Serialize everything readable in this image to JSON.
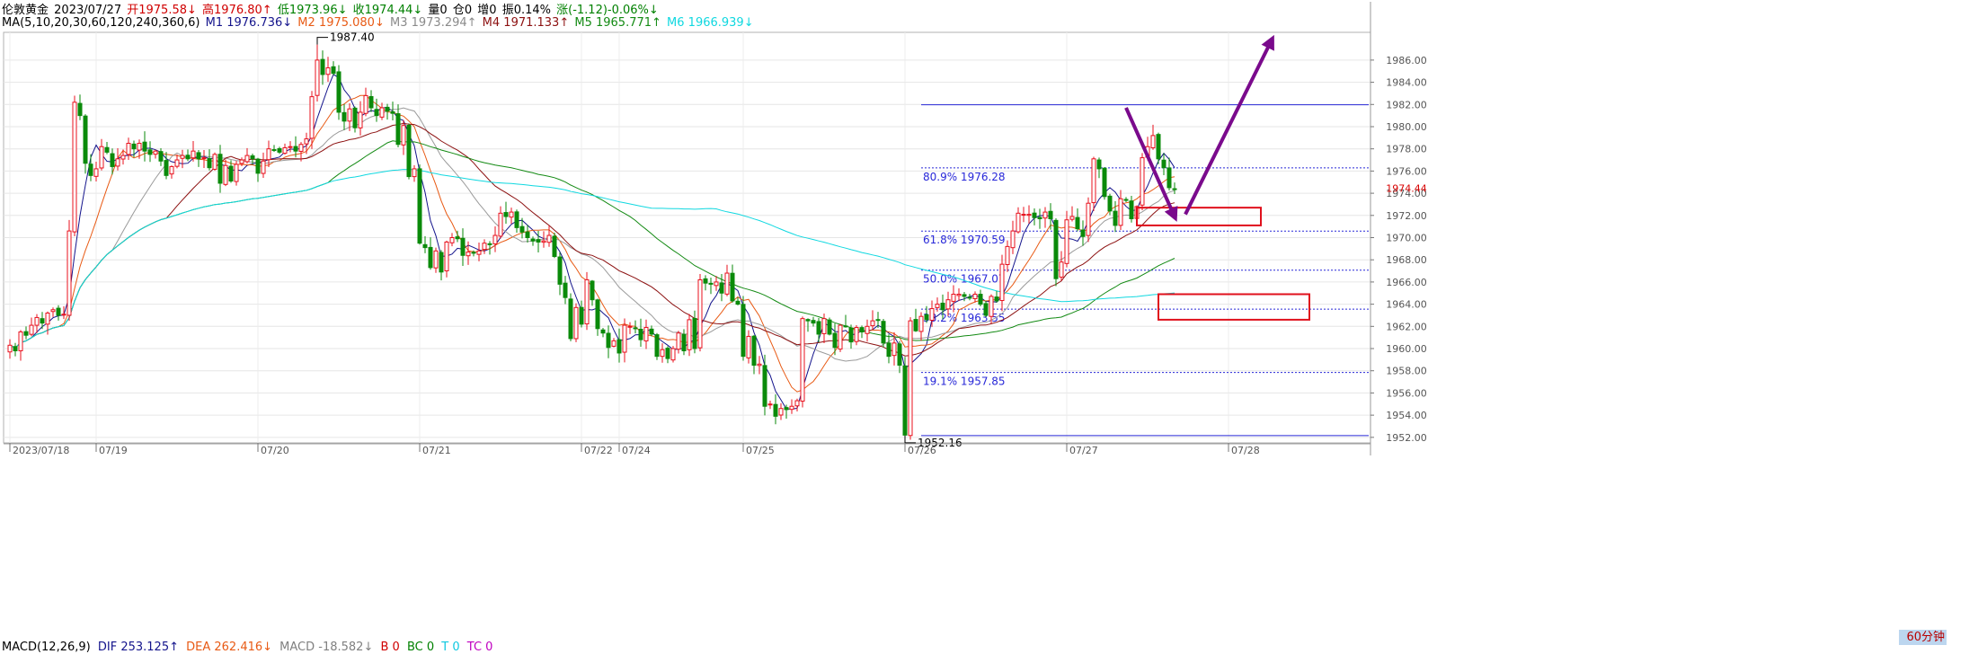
{
  "header": {
    "instrument": "伦敦黄金",
    "date": "2023/07/27",
    "open": "开1975.58↓",
    "high": "高1976.80↑",
    "low": "低1973.96↓",
    "close": "收1974.44↓",
    "volume": "量0",
    "position": "仓0",
    "increase": "增0",
    "amplitude": "振0.14%",
    "change": "涨(-1.12)-0.06%↓"
  },
  "ma_header": {
    "label": "MA(5,10,20,30,60,120,240,360,6)",
    "m1": "M1 1976.736↓",
    "m2": "M2 1975.080↓",
    "m3": "M3 1973.294↑",
    "m4": "M4 1971.133↑",
    "m5": "M5 1965.771↑",
    "m6": "M6 1966.939↓"
  },
  "footer": {
    "macd_label": "MACD(12,26,9)",
    "dif": "DIF 253.125↑",
    "dea": "DEA 262.416↓",
    "macd": "MACD -18.582↓",
    "b": "B 0",
    "bc": "BC 0",
    "t": "T 0",
    "tc": "TC 0"
  },
  "timeframe_button": "60分钟",
  "colors": {
    "up": "#e8101c",
    "down": "#0a8a0a",
    "m1": "#14148c",
    "m2": "#e85a14",
    "m3": "#9a9a9a",
    "m4": "#8c1010",
    "m5": "#138a13",
    "m6": "#10d8e0",
    "fib": "#2828d8",
    "arrow": "#7a0a8c",
    "box": "#e0101c",
    "axis_price_highlight": "#d80000"
  },
  "chart_data": {
    "type": "candlestick",
    "title": "伦敦黄金 60分钟",
    "ylim": [
      1951.5,
      1988.5
    ],
    "y_ticks": [
      "1986.00",
      "1984.00",
      "1982.00",
      "1980.00",
      "1978.00",
      "1976.00",
      "1974.00",
      "1972.00",
      "1970.00",
      "1968.00",
      "1966.00",
      "1964.00",
      "1962.00",
      "1960.00",
      "1958.00",
      "1956.00",
      "1954.00",
      "1952.00"
    ],
    "y_tick_values": [
      1986,
      1984,
      1982,
      1980,
      1978,
      1976,
      1974,
      1972,
      1970,
      1968,
      1966,
      1964,
      1962,
      1960,
      1958,
      1956,
      1954,
      1952
    ],
    "current_price": "1974.44",
    "current_price_value": 1974.44,
    "x_labels": [
      {
        "label": "2023/07/18",
        "bar": 0
      },
      {
        "label": "07/19",
        "bar": 16
      },
      {
        "label": "07/20",
        "bar": 46
      },
      {
        "label": "07/21",
        "bar": 76
      },
      {
        "label": "07/22",
        "bar": 106
      },
      {
        "label": "07/24",
        "bar": 113
      },
      {
        "label": "07/25",
        "bar": 136
      },
      {
        "label": "07/26",
        "bar": 166
      },
      {
        "label": "07/27",
        "bar": 196
      },
      {
        "label": "07/28",
        "bar": 226
      }
    ],
    "bar_count": 244,
    "max_annotation": {
      "label": "1987.40",
      "value": 1987.4
    },
    "min_annotation": {
      "label": "1952.16",
      "value": 1952.16
    },
    "closes": [
      1960.3,
      1959.8,
      1961.5,
      1961.2,
      1962.1,
      1962.8,
      1962.3,
      1963.2,
      1963.5,
      1963.0,
      1963.1,
      1970.6,
      1982.2,
      1981.0,
      1976.7,
      1975.6,
      1976.2,
      1978.2,
      1977.7,
      1976.4,
      1977.1,
      1977.4,
      1978.5,
      1978.0,
      1978.5,
      1977.8,
      1977.5,
      1977.8,
      1976.9,
      1975.6,
      1976.4,
      1977.0,
      1977.4,
      1977.1,
      1977.8,
      1977.1,
      1977.2,
      1976.3,
      1977.5,
      1974.9,
      1976.5,
      1975.1,
      1976.6,
      1977.0,
      1977.4,
      1977.1,
      1975.8,
      1976.9,
      1978.0,
      1977.9,
      1977.7,
      1978.1,
      1978.2,
      1977.8,
      1978.4,
      1978.9,
      1982.7,
      1986.0,
      1984.7,
      1985.3,
      1984.8,
      1981.3,
      1980.5,
      1981.6,
      1979.9,
      1981.3,
      1982.8,
      1981.7,
      1981.0,
      1981.7,
      1981.4,
      1981.2,
      1978.4,
      1980.1,
      1975.5,
      1976.2,
      1969.5,
      1969.1,
      1967.3,
      1968.8,
      1966.9,
      1969.6,
      1970.0,
      1969.9,
      1968.4,
      1968.7,
      1968.6,
      1968.8,
      1969.5,
      1969.4,
      1970.2,
      1972.2,
      1971.9,
      1972.3,
      1970.9,
      1970.5,
      1970.0,
      1969.7,
      1969.6,
      1969.7,
      1970.2,
      1968.3,
      1965.8,
      1964.6,
      1960.9,
      1963.7,
      1962.2,
      1966.2,
      1964.4,
      1961.8,
      1961.4,
      1960.1,
      1960.7,
      1959.6,
      1962.1,
      1962.0,
      1961.8,
      1960.8,
      1961.9,
      1961.3,
      1959.3,
      1959.9,
      1959.1,
      1960.0,
      1961.4,
      1959.8,
      1962.6,
      1960.0,
      1966.2,
      1965.9,
      1965.8,
      1966.0,
      1965.0,
      1966.8,
      1964.3,
      1964.0,
      1959.3,
      1961.1,
      1958.5,
      1958.6,
      1954.8,
      1955.0,
      1953.9,
      1954.6,
      1954.5,
      1954.8,
      1955.3,
      1962.7,
      1962.5,
      1962.3,
      1961.3,
      1962.7,
      1961.3,
      1960.1,
      1962.1,
      1962.0,
      1960.6,
      1961.9,
      1961.5,
      1962.0,
      1962.5,
      1962.6,
      1960.5,
      1959.3,
      1960.5,
      1958.5,
      1952.2,
      1962.5,
      1961.6,
      1962.9,
      1962.6,
      1963.6,
      1964.0,
      1963.5,
      1964.4,
      1964.9,
      1964.9,
      1964.7,
      1964.6,
      1964.9,
      1964.0,
      1963.0,
      1964.7,
      1964.3,
      1967.6,
      1969.2,
      1970.6,
      1972.2,
      1972.1,
      1972.1,
      1971.8,
      1971.7,
      1972.3,
      1971.7,
      1966.3,
      1967.8,
      1971.6,
      1971.9,
      1970.8,
      1970.1,
      1973.1,
      1977.1,
      1976.2,
      1973.7,
      1972.4,
      1971.1,
      1973.5,
      1973.4,
      1971.7,
      1972.8,
      1977.2,
      1978.2,
      1979.2,
      1977.1,
      1976.3,
      1974.5,
      1974.4
    ],
    "fib_levels": [
      {
        "label": "80.9% 1976.28",
        "value": 1976.28
      },
      {
        "label": "61.8% 1970.59",
        "value": 1970.59
      },
      {
        "label": "50.0% 1967.07",
        "value": 1967.07
      },
      {
        "label": "38.2% 1963.55",
        "value": 1963.55
      },
      {
        "label": "19.1% 1957.85",
        "value": 1957.85
      }
    ],
    "fib_top": 1981.97,
    "fib_bottom": 1952.16
  }
}
